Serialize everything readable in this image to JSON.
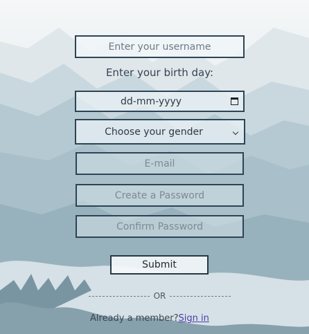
{
  "form": {
    "username_placeholder": "Enter your username",
    "birth_label": "Enter your birth day:",
    "date_value": "dd-mm-yyyy",
    "gender_selected": "Choose your gender",
    "email_placeholder": "E-mail",
    "password_placeholder": "Create a Password",
    "confirm_placeholder": "Confirm Password",
    "submit_label": "Submit",
    "or_label": "OR",
    "member_prompt": "Already a member?",
    "signin_link": "Sign in"
  },
  "icons": {
    "calendar": "calendar-icon",
    "dropdown": "chevron-down-icon"
  },
  "colors": {
    "field_border": "#2c4454",
    "link": "#4c3ca8",
    "sky_top": "#f4f7f8",
    "mountain": "#9fb7c2"
  }
}
